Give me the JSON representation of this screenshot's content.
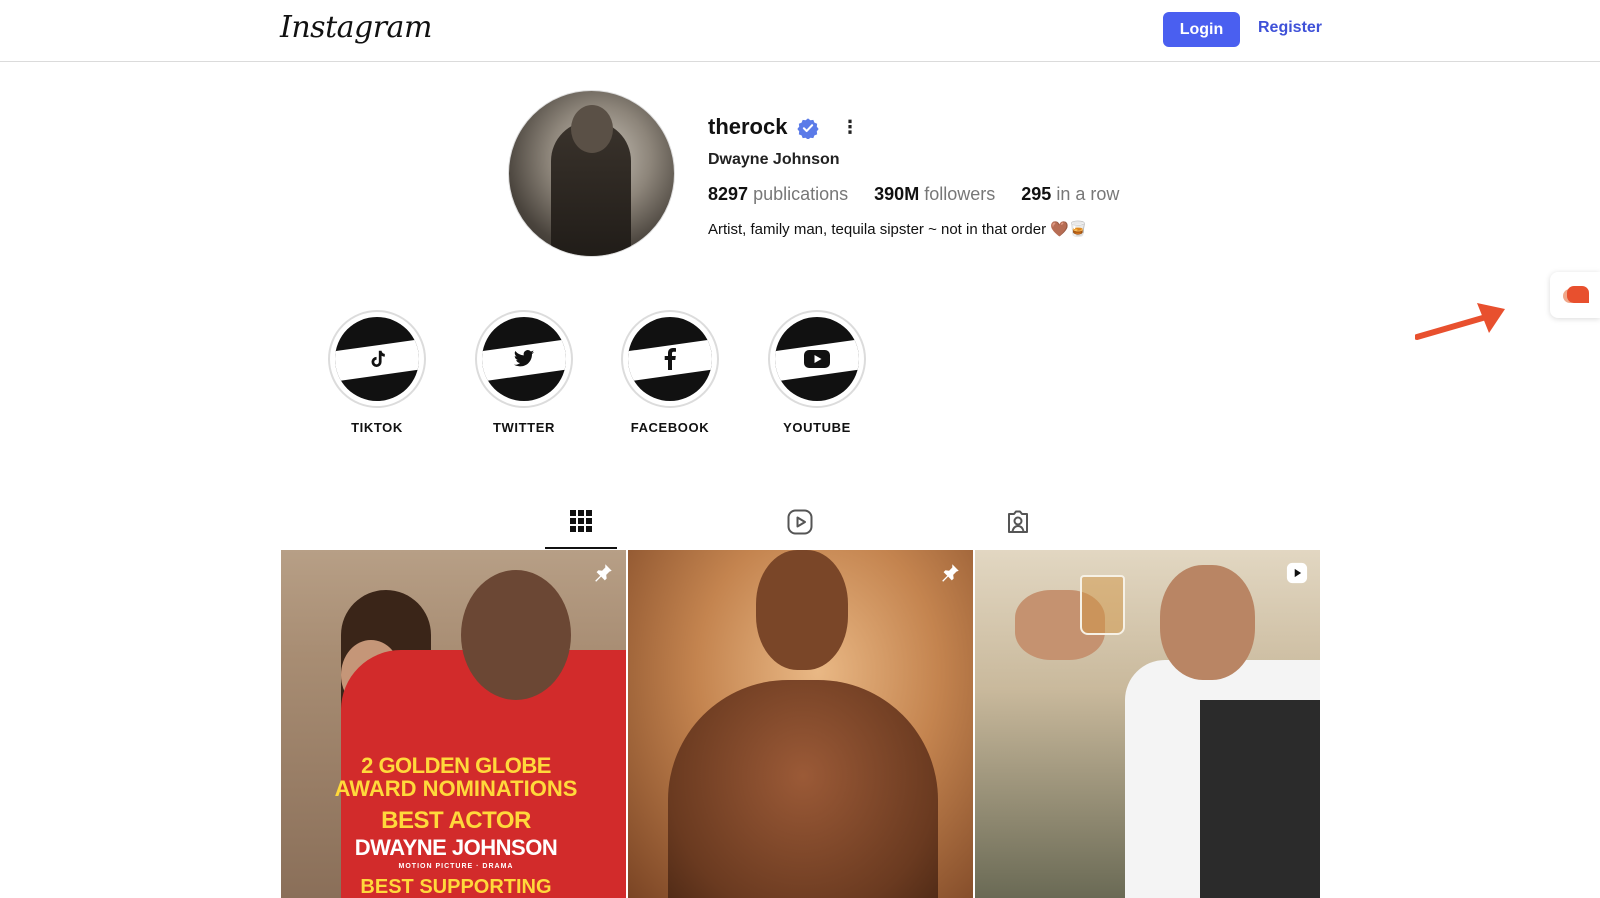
{
  "header": {
    "logo": "Instagram",
    "login_label": "Login",
    "register_label": "Register"
  },
  "profile": {
    "username": "therock",
    "full_name": "Dwayne Johnson",
    "stats": [
      {
        "value": "8297",
        "label": "publications"
      },
      {
        "value": "390M",
        "label": "followers"
      },
      {
        "value": "295",
        "label": "in a row"
      }
    ],
    "bio": "Artist, family man, tequila sipster ~ not in that order 🤎🥃"
  },
  "highlights": [
    {
      "label": "TIKTOK",
      "icon": "tiktok-icon"
    },
    {
      "label": "TWITTER",
      "icon": "twitter-icon"
    },
    {
      "label": "FACEBOOK",
      "icon": "facebook-icon"
    },
    {
      "label": "YOUTUBE",
      "icon": "youtube-icon"
    }
  ],
  "tabs": [
    {
      "icon": "grid-icon",
      "active": true
    },
    {
      "icon": "reels-icon",
      "active": false
    },
    {
      "icon": "tagged-icon",
      "active": false
    }
  ],
  "posts": [
    {
      "badge": "pin-icon",
      "overlay": {
        "l1": "2 GOLDEN GLOBE",
        "l2": "AWARD NOMINATIONS",
        "l3": "BEST ACTOR",
        "l4": "DWAYNE JOHNSON",
        "l5": "MOTION PICTURE · DRAMA",
        "l6": "BEST SUPPORTING ACTRESS"
      }
    },
    {
      "badge": "pin-icon"
    },
    {
      "badge": "reel-play-icon"
    }
  ],
  "colors": {
    "accent": "#4a5ff0",
    "link": "#3f51d8",
    "verified": "#5b7be8",
    "annotation_arrow": "#e8502e"
  }
}
